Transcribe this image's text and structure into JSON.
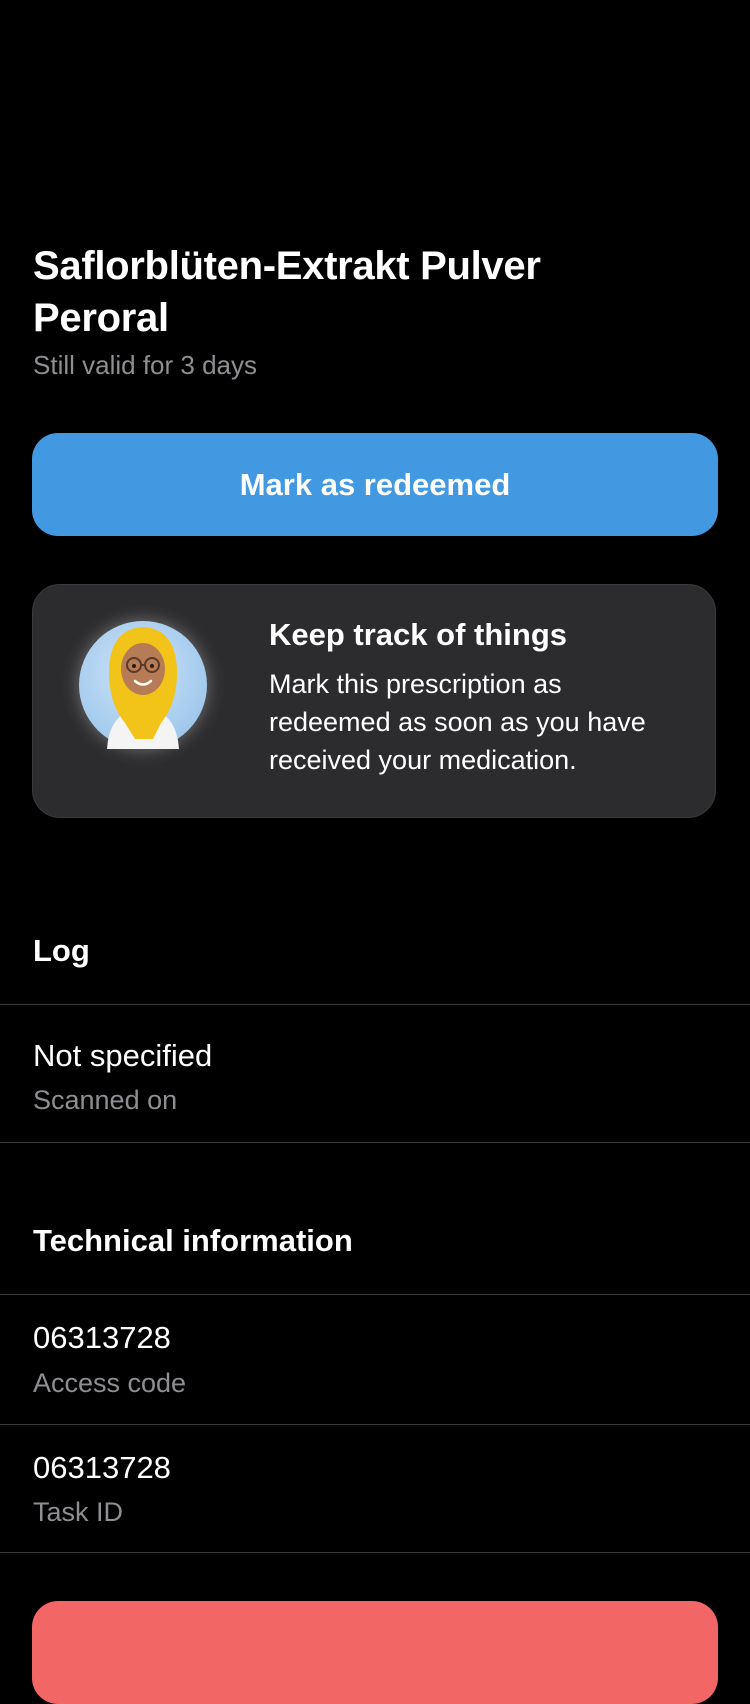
{
  "prescription": {
    "title": "Saflorblüten-Extrakt Pulver Peroral",
    "validity": "Still valid for 3 days"
  },
  "actions": {
    "redeem_label": "Mark as redeemed"
  },
  "hint": {
    "title": "Keep track of things",
    "text": "Mark this prescription as redeemed as soon as you have received your medication.",
    "avatar_icon": "pharmacist-avatar"
  },
  "log": {
    "header": "Log",
    "entries": [
      {
        "value": "Not specified",
        "label": "Scanned on"
      }
    ]
  },
  "technical": {
    "header": "Technical information",
    "rows": [
      {
        "value": "06313728",
        "label": "Access code"
      },
      {
        "value": "06313728",
        "label": "Task ID"
      }
    ]
  },
  "colors": {
    "background": "#000000",
    "primary": "#4299e1",
    "danger": "#f26665",
    "card": "#2c2c2e",
    "secondary_text": "#8e8e93"
  }
}
